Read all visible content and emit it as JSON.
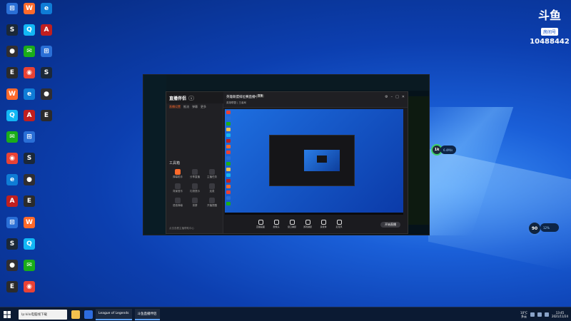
{
  "desktop": {
    "icons": [
      {
        "label": "Windows",
        "color": "#2a6fd6",
        "glyph": "⊞"
      },
      {
        "label": "Steam",
        "color": "#1b2838",
        "glyph": "S"
      },
      {
        "label": "OBS",
        "color": "#302e31",
        "glyph": "●"
      },
      {
        "label": "Epic",
        "color": "#2b2b2b",
        "glyph": "E"
      },
      {
        "label": "WeGame",
        "color": "#ff6a2b",
        "glyph": "W"
      },
      {
        "label": "QQ",
        "color": "#12b7f5",
        "glyph": "Q"
      },
      {
        "label": "WeChat",
        "color": "#1aad19",
        "glyph": "✉"
      },
      {
        "label": "Chrome",
        "color": "#e94235",
        "glyph": "◉"
      },
      {
        "label": "Edge",
        "color": "#0f7cd6",
        "glyph": "e"
      },
      {
        "label": "Apex",
        "color": "#c01f1f",
        "glyph": "A"
      }
    ]
  },
  "overlay": {
    "brand": "斗鱼",
    "room_tag": "房间号",
    "room_no": "10488442"
  },
  "stream_app": {
    "brand": "直播伴侣",
    "tabs": [
      "直播设置",
      "推流",
      "弹幕",
      "更多"
    ],
    "toolbox_title": "工具箱",
    "tools": [
      "弹幕助手",
      "分享直播",
      "主播任务",
      "背景音乐",
      "礼物提示",
      "连麦",
      "语音弹幕",
      "录屏",
      "开播提醒"
    ],
    "room_title": "英雄联盟排位赛直播中",
    "live_badge": "直播",
    "category": "英雄联盟 | 王者局",
    "controls": [
      "直播画面",
      "摄像头",
      "窗口捕捉",
      "游戏捕捉",
      "多媒体",
      "麦克风"
    ],
    "start_button": "开始直播",
    "footnote": "点击查看主播帮助中心"
  },
  "widgets": {
    "ring1": "1k",
    "pill1": "6.4M/s",
    "ring2": "90",
    "pill2": "12%"
  },
  "taskbar": {
    "search_text": "Ip:kilo电脑线下载",
    "tasks": [
      "League of Legends",
      "斗鱼直播伴侣"
    ],
    "time": "13:45",
    "date": "2021/11/24",
    "weather": "10°C",
    "weather_sub": "多云"
  }
}
